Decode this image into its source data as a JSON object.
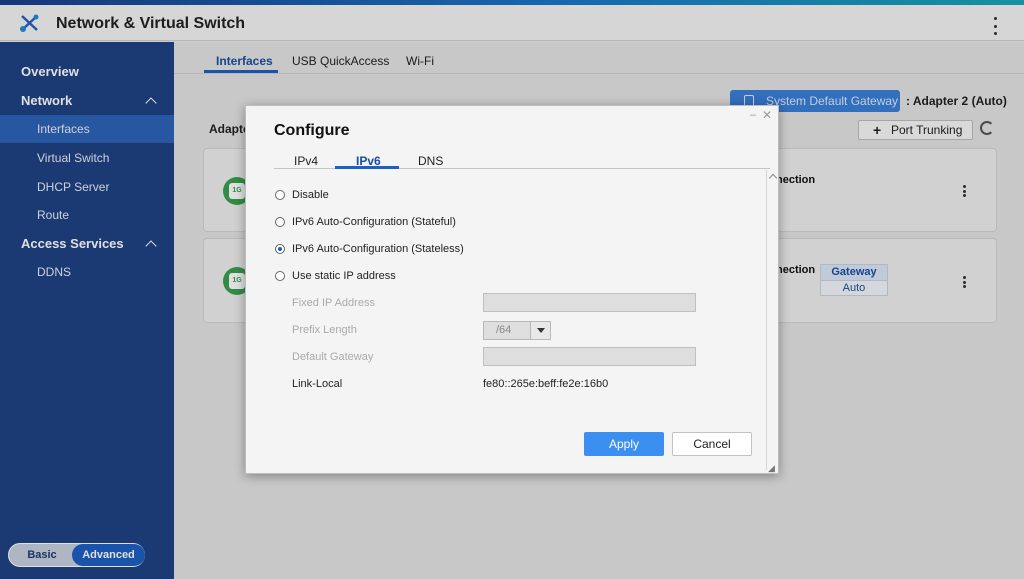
{
  "app": {
    "title": "Network & Virtual Switch",
    "icon": "network-switch-icon",
    "menu_icon": "kebab-menu-icon"
  },
  "sidebar": {
    "items": [
      {
        "label": "Overview",
        "type": "section"
      },
      {
        "label": "Network",
        "type": "section",
        "expanded": true
      },
      {
        "label": "Interfaces",
        "type": "sub",
        "active": true
      },
      {
        "label": "Virtual Switch",
        "type": "sub"
      },
      {
        "label": "DHCP Server",
        "type": "sub"
      },
      {
        "label": "Route",
        "type": "sub"
      },
      {
        "label": "Access Services",
        "type": "section",
        "expanded": true
      },
      {
        "label": "DDNS",
        "type": "sub"
      }
    ],
    "mode": {
      "basic": "Basic",
      "advanced": "Advanced",
      "selected": "Advanced"
    }
  },
  "main": {
    "tabs": [
      {
        "label": "Interfaces",
        "active": true
      },
      {
        "label": "USB QuickAccess"
      },
      {
        "label": "Wi-Fi"
      }
    ],
    "gateway_button": "System Default Gateway",
    "gateway_value": ": Adapter 2 (Auto)",
    "port_trunking": "Port Trunking",
    "adapters_label": "Adapte",
    "cards": [
      {
        "icon_text": "1G",
        "connection": "nection"
      },
      {
        "icon_text": "1G",
        "connection": "nection",
        "badge_top": "Gateway",
        "badge_bottom": "Auto"
      }
    ]
  },
  "dialog": {
    "title": "Configure",
    "tabs": [
      {
        "label": "IPv4"
      },
      {
        "label": "IPv6",
        "active": true
      },
      {
        "label": "DNS"
      }
    ],
    "options": [
      {
        "label": "Disable",
        "checked": false
      },
      {
        "label": "IPv6 Auto-Configuration (Stateful)",
        "checked": false
      },
      {
        "label": "IPv6 Auto-Configuration (Stateless)",
        "checked": true
      },
      {
        "label": "Use static IP address",
        "checked": false
      }
    ],
    "fields": {
      "fixed_ip_label": "Fixed IP Address",
      "fixed_ip_value": "",
      "prefix_label": "Prefix Length",
      "prefix_value": "/64",
      "gateway_label": "Default Gateway",
      "gateway_value": "",
      "link_local_label": "Link-Local",
      "link_local_value": "fe80::265e:beff:fe2e:16b0"
    },
    "apply": "Apply",
    "cancel": "Cancel"
  }
}
